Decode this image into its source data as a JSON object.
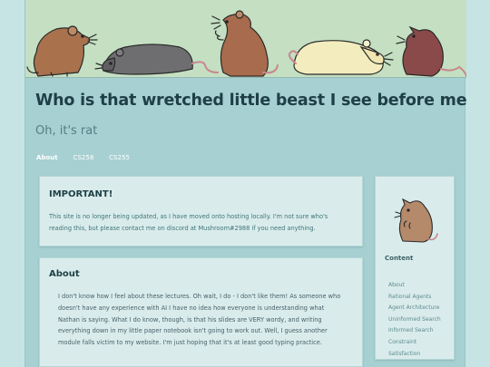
{
  "site": {
    "title": "Who is that wretched little beast I see before me",
    "subtitle": "Oh, it's rat"
  },
  "nav": {
    "items": [
      {
        "label": "About",
        "active": true
      },
      {
        "label": "CS258",
        "active": false
      },
      {
        "label": "CS255",
        "active": false
      }
    ]
  },
  "notice": {
    "heading": "IMPORTANT!",
    "body": "This site is no longer being updated, as I have moved onto hosting locally. I'm not sure who's reading this, but please contact me on discord at Mushroom#2988 if you need anything."
  },
  "about": {
    "heading": "About",
    "body": "I don't know how I feel about these lectures. Oh wait, I do - I don't like them! As someone who doesn't have any experience with AI I have no idea how everyone is understanding what Nathan is saying. What I do know, though, is that his slides are VERY wordy, and writing everything down in my little paper notebook isn't going to work out. Well, I guess another module falls victim to my website. I'm just hoping that it's at least good typing practice."
  },
  "sidebar": {
    "heading": "Content",
    "links": [
      "About",
      "Rational Agents",
      "Agent Architecture",
      "Uninformed Search",
      "Informed Search",
      "Constraint",
      "Satisfaction"
    ]
  },
  "colors": {
    "page_bg": "#c5e4e3",
    "content_bg": "#a7d0d2",
    "card_bg": "#d9eceb",
    "banner_bg": "#c4dfc2",
    "title": "#1f3f46"
  },
  "icons": {
    "banner": "rat-banner-illustration",
    "avatar": "sitting-rat-icon"
  }
}
